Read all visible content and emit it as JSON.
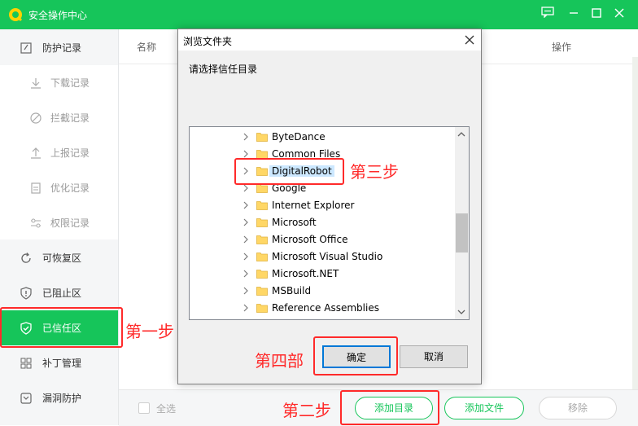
{
  "app": {
    "title": "安全操作中心"
  },
  "colors": {
    "brand": "#16c55a",
    "annotation": "#ff2a2a",
    "selection": "#cce8ff"
  },
  "sidebar": {
    "items": [
      {
        "label": "防护记录",
        "icon": "record-icon"
      },
      {
        "label": "下载记录",
        "icon": "download-icon"
      },
      {
        "label": "拦截记录",
        "icon": "block-icon"
      },
      {
        "label": "上报记录",
        "icon": "upload-icon"
      },
      {
        "label": "优化记录",
        "icon": "clipboard-icon"
      },
      {
        "label": "权限记录",
        "icon": "sliders-icon"
      },
      {
        "label": "可恢复区",
        "icon": "restore-icon"
      },
      {
        "label": "已阻止区",
        "icon": "shield-alert-icon"
      },
      {
        "label": "已信任区",
        "icon": "shield-check-icon",
        "active": true
      },
      {
        "label": "补丁管理",
        "icon": "grid-icon"
      },
      {
        "label": "漏洞防护",
        "icon": "bug-shield-icon"
      }
    ]
  },
  "main": {
    "columns": {
      "name": "名称",
      "operation": "操作"
    },
    "footer": {
      "select_all": "全选",
      "add_dir": "添加目录",
      "add_file": "添加文件",
      "remove": "移除"
    }
  },
  "dialog": {
    "title": "浏览文件夹",
    "prompt": "请选择信任目录",
    "folders": [
      "ByteDance",
      "Common Files",
      "DigitalRobot",
      "Google",
      "Internet Explorer",
      "Microsoft",
      "Microsoft Office",
      "Microsoft Visual Studio",
      "Microsoft.NET",
      "MSBuild",
      "Reference Assemblies"
    ],
    "selected": "DigitalRobot",
    "ok": "确定",
    "cancel": "取消"
  },
  "annotations": {
    "step1": "第一步",
    "step2": "第二步",
    "step3": "第三步",
    "step4": "第四部"
  }
}
